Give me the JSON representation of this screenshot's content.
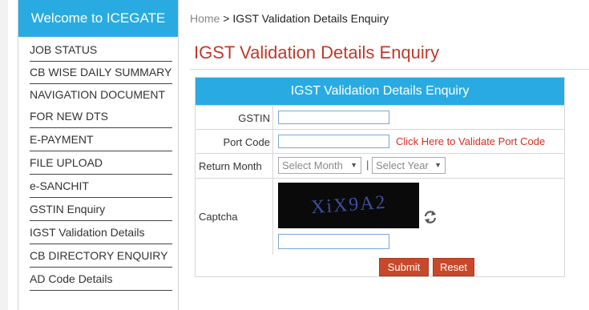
{
  "sidebar": {
    "header": "Welcome to ICEGATE",
    "items": [
      {
        "label": "JOB STATUS"
      },
      {
        "label": "CB WISE DAILY SUMMARY"
      },
      {
        "label": "NAVIGATION DOCUMENT FOR NEW DTS"
      },
      {
        "label": "E-PAYMENT"
      },
      {
        "label": "FILE UPLOAD"
      },
      {
        "label": "e-SANCHIT"
      },
      {
        "label": "GSTIN Enquiry"
      },
      {
        "label": "IGST Validation Details"
      },
      {
        "label": "CB DIRECTORY ENQUIRY"
      },
      {
        "label": "AD Code Details"
      }
    ]
  },
  "breadcrumb": {
    "home": "Home",
    "separator": ">",
    "current": "IGST Validation Details Enquiry"
  },
  "page_title": "IGST Validation Details Enquiry",
  "form": {
    "header": "IGST Validation Details Enquiry",
    "gstin_label": "GSTIN",
    "gstin_value": "",
    "port_code_label": "Port Code",
    "port_code_value": "",
    "port_code_link": "Click Here to Validate Port Code",
    "return_month_label": "Return Month",
    "month_select": "Select Month",
    "year_select": "Select Year",
    "separator": "|",
    "captcha_label": "Captcha",
    "captcha_text": "XiX9A2",
    "captcha_value": "",
    "submit": "Submit",
    "reset": "Reset"
  },
  "colors": {
    "accent": "#29abe2",
    "title": "#c0392b",
    "button": "#c8482c",
    "link": "#d62d20"
  }
}
